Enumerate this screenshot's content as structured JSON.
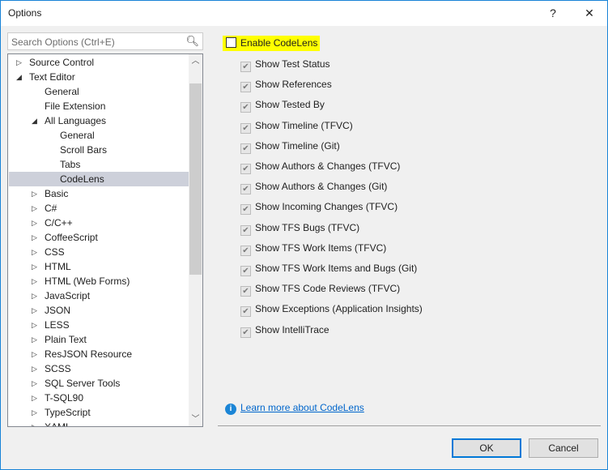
{
  "window": {
    "title": "Options",
    "help": "?",
    "close": "✕"
  },
  "search": {
    "placeholder": "Search Options (Ctrl+E)",
    "icon": "search-icon"
  },
  "tree": [
    {
      "label": "Source Control",
      "level": 0,
      "expander": "collapsed"
    },
    {
      "label": "Text Editor",
      "level": 0,
      "expander": "expanded"
    },
    {
      "label": "General",
      "level": 1,
      "expander": "none"
    },
    {
      "label": "File Extension",
      "level": 1,
      "expander": "none"
    },
    {
      "label": "All Languages",
      "level": 1,
      "expander": "expanded"
    },
    {
      "label": "General",
      "level": 2,
      "expander": "none"
    },
    {
      "label": "Scroll Bars",
      "level": 2,
      "expander": "none"
    },
    {
      "label": "Tabs",
      "level": 2,
      "expander": "none"
    },
    {
      "label": "CodeLens",
      "level": 2,
      "expander": "none",
      "selected": true
    },
    {
      "label": "Basic",
      "level": 1,
      "expander": "collapsed"
    },
    {
      "label": "C#",
      "level": 1,
      "expander": "collapsed"
    },
    {
      "label": "C/C++",
      "level": 1,
      "expander": "collapsed"
    },
    {
      "label": "CoffeeScript",
      "level": 1,
      "expander": "collapsed"
    },
    {
      "label": "CSS",
      "level": 1,
      "expander": "collapsed"
    },
    {
      "label": "HTML",
      "level": 1,
      "expander": "collapsed"
    },
    {
      "label": "HTML (Web Forms)",
      "level": 1,
      "expander": "collapsed"
    },
    {
      "label": "JavaScript",
      "level": 1,
      "expander": "collapsed"
    },
    {
      "label": "JSON",
      "level": 1,
      "expander": "collapsed"
    },
    {
      "label": "LESS",
      "level": 1,
      "expander": "collapsed"
    },
    {
      "label": "Plain Text",
      "level": 1,
      "expander": "collapsed"
    },
    {
      "label": "ResJSON Resource",
      "level": 1,
      "expander": "collapsed"
    },
    {
      "label": "SCSS",
      "level": 1,
      "expander": "collapsed"
    },
    {
      "label": "SQL Server Tools",
      "level": 1,
      "expander": "collapsed"
    },
    {
      "label": "T-SQL90",
      "level": 1,
      "expander": "collapsed"
    },
    {
      "label": "TypeScript",
      "level": 1,
      "expander": "collapsed"
    },
    {
      "label": "XAML",
      "level": 1,
      "expander": "collapsed"
    }
  ],
  "codelens": {
    "enable_label": "Enable CodeLens",
    "enabled": false,
    "highlight_color": "#ffff00",
    "options": [
      {
        "label": "Show Test Status",
        "checked": true
      },
      {
        "label": "Show References",
        "checked": true
      },
      {
        "label": "Show Tested By",
        "checked": true
      },
      {
        "label": "Show Timeline (TFVC)",
        "checked": true
      },
      {
        "label": "Show Timeline (Git)",
        "checked": true
      },
      {
        "label": "Show Authors & Changes (TFVC)",
        "checked": true
      },
      {
        "label": "Show Authors & Changes (Git)",
        "checked": true
      },
      {
        "label": "Show Incoming Changes (TFVC)",
        "checked": true
      },
      {
        "label": "Show TFS Bugs (TFVC)",
        "checked": true
      },
      {
        "label": "Show TFS Work Items (TFVC)",
        "checked": true
      },
      {
        "label": "Show TFS Work Items and Bugs (Git)",
        "checked": true
      },
      {
        "label": "Show TFS Code Reviews (TFVC)",
        "checked": true
      },
      {
        "label": "Show Exceptions (Application Insights)",
        "checked": true
      },
      {
        "label": "Show IntelliTrace",
        "checked": true
      }
    ],
    "learn_more": "Learn more about CodeLens"
  },
  "buttons": {
    "ok": "OK",
    "cancel": "Cancel"
  }
}
